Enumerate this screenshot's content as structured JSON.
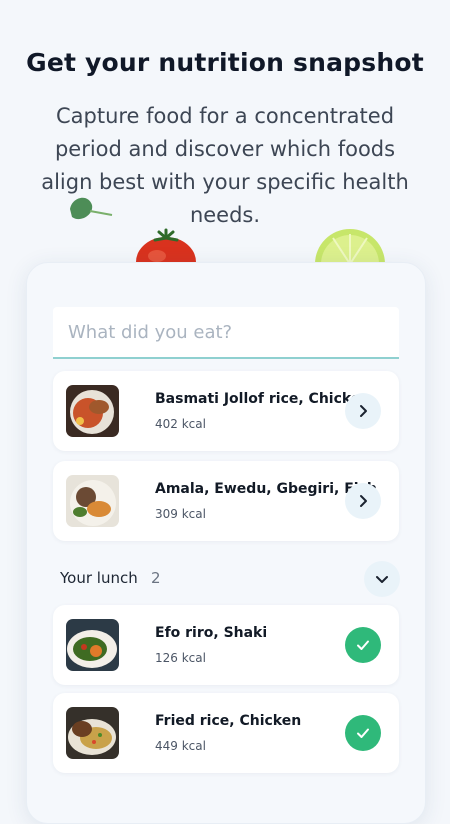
{
  "header": {
    "title": "Get your nutrition snapshot",
    "subtitle": "Capture food for a concentrated period and discover which foods align best with your specific health needs."
  },
  "search": {
    "placeholder": "What did you eat?",
    "value": ""
  },
  "recent_items": [
    {
      "name": "Basmati Jollof rice, Chicken",
      "kcal": "402 kcal",
      "action_icon": "chevron-right-icon"
    },
    {
      "name": "Amala, Ewedu, Gbegiri, Fish",
      "kcal": "309 kcal",
      "action_icon": "chevron-right-icon"
    }
  ],
  "lunch_section": {
    "label": "Your lunch",
    "count": "2",
    "toggle_icon": "chevron-down-icon",
    "items": [
      {
        "name": "Efo riro, Shaki",
        "kcal": "126 kcal",
        "status_icon": "check-icon"
      },
      {
        "name": "Fried rice, Chicken",
        "kcal": "449 kcal",
        "status_icon": "check-icon"
      }
    ]
  },
  "colors": {
    "background": "#f4f7fb",
    "accent_check": "#2fb97a",
    "search_underline": "#8fd0d0",
    "button_bg": "#e9f3f9"
  }
}
